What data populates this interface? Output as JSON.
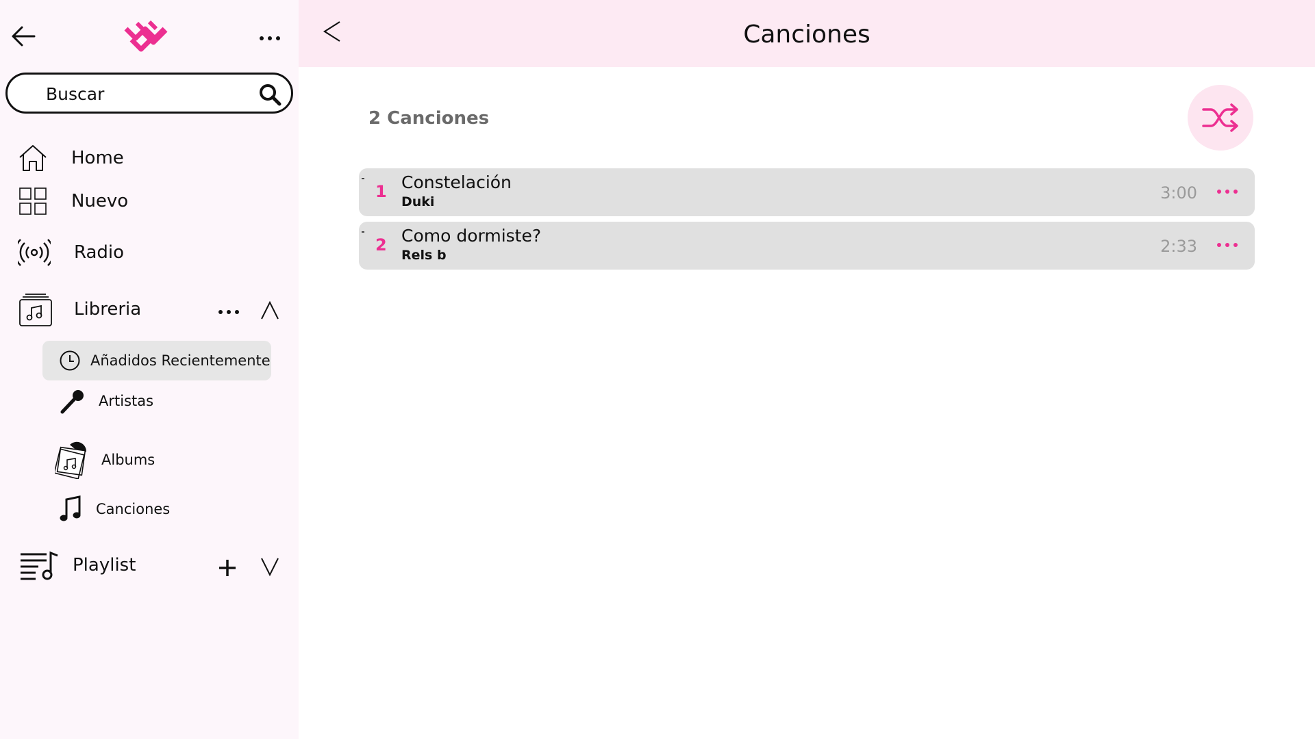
{
  "sidebar": {
    "search": {
      "placeholder": "Buscar"
    },
    "nav": {
      "home": "Home",
      "nuevo": "Nuevo",
      "radio": "Radio",
      "libreria": "Libreria",
      "playlist": "Playlist"
    },
    "library_items": {
      "recent": "Añadidos Recientemente",
      "artistas": "Artistas",
      "albums": "Albums",
      "canciones": "Canciones"
    }
  },
  "main": {
    "title": "Canciones",
    "count": "2 Canciones",
    "songs": [
      {
        "number": "1",
        "title": "Constelación",
        "artist": "Duki",
        "duration": "3:00"
      },
      {
        "number": "2",
        "title": "Como dormiste?",
        "artist": "Rels b",
        "duration": "2:33"
      }
    ]
  },
  "colors": {
    "accent": "#ec2f91",
    "header_bg": "#fdeaf3",
    "sidebar_bg": "#fdf6fb",
    "row_bg": "#e0e0e0"
  },
  "icons": [
    "back-arrow-icon",
    "logo-icon",
    "more-icon",
    "search-icon",
    "home-icon",
    "grid-icon",
    "radio-icon",
    "library-icon",
    "chevron-up-icon",
    "clock-icon",
    "microphone-icon",
    "album-icon",
    "music-note-icon",
    "playlist-icon",
    "plus-icon",
    "chevron-down-icon",
    "shuffle-icon"
  ]
}
